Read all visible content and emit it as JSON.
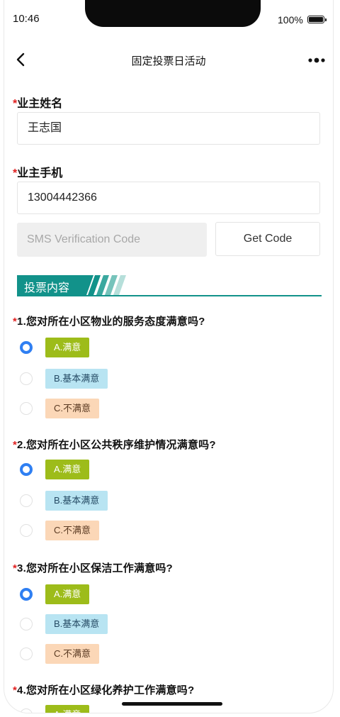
{
  "status": {
    "time": "10:46",
    "battery": "100%"
  },
  "nav": {
    "title": "固定投票日活动"
  },
  "form": {
    "owner_name_label": "业主姓名",
    "owner_name_value": "王志国",
    "owner_phone_label": "业主手机",
    "owner_phone_value": "13004442366",
    "sms_placeholder": "SMS Verification Code",
    "get_code_label": "Get Code"
  },
  "section": {
    "title": "投票内容"
  },
  "required_mark": "*",
  "colors": {
    "accent": "#12928a",
    "radio_checked": "#2f7ff2",
    "option_a": "#9dbc1a",
    "option_b": "#b8e4f2",
    "option_c": "#fbd7b7",
    "required": "#e02020"
  },
  "questions": [
    {
      "text": "1.您对所在小区物业的服务态度满意吗?",
      "options": [
        "A.满意",
        "B.基本满意",
        "C.不满意"
      ],
      "selected": 0
    },
    {
      "text": "2.您对所在小区公共秩序维护情况满意吗?",
      "options": [
        "A.满意",
        "B.基本满意",
        "C.不满意"
      ],
      "selected": 0
    },
    {
      "text": "3.您对所在小区保洁工作满意吗?",
      "options": [
        "A.满意",
        "B.基本满意",
        "C.不满意"
      ],
      "selected": 0
    },
    {
      "text": "4.您对所在小区绿化养护工作满意吗?",
      "options": [
        "A.满意"
      ],
      "selected": 0
    }
  ]
}
